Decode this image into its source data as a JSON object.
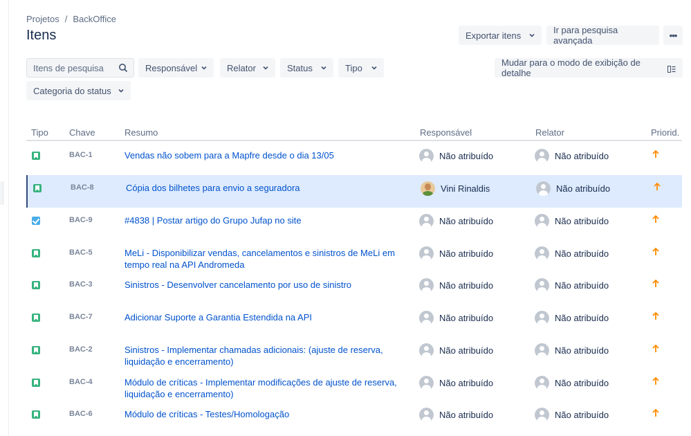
{
  "breadcrumb": {
    "project": "Projetos",
    "separator": "/",
    "current": "BackOffice"
  },
  "page": {
    "title": "Itens"
  },
  "toolbar": {
    "export_label": "Exportar itens",
    "advanced_search_label": "Ir para pesquisa avançada",
    "more_label": "•••",
    "detail_view_label": "Mudar para o modo de exibição de detalhe"
  },
  "filters": {
    "search_placeholder": "Itens de pesquisa",
    "assignee": "Responsável",
    "reporter": "Relator",
    "status": "Status",
    "type": "Tipo",
    "status_category": "Categoria do status"
  },
  "table": {
    "headers": {
      "type": "Tipo",
      "key": "Chave",
      "summary": "Resumo",
      "assignee": "Responsável",
      "reporter": "Relator",
      "priority": "Priorid."
    },
    "rows": [
      {
        "type": "story",
        "key": "BAC-1",
        "summary": "Vendas não sobem para a Mapfre desde o dia 13/05",
        "assignee": "Não atribuído",
        "reporter": "Não atribuído",
        "priority": "medium"
      },
      {
        "type": "story",
        "key": "BAC-8",
        "summary": "Cópia dos bilhetes para envio a seguradora",
        "assignee": "Vini Rinaldis",
        "reporter": "Não atribuído",
        "priority": "medium"
      },
      {
        "type": "task",
        "key": "BAC-9",
        "summary": "#4838 | Postar artigo do Grupo Jufap no site",
        "assignee": "Não atribuído",
        "reporter": "Não atribuído",
        "priority": "medium"
      },
      {
        "type": "story",
        "key": "BAC-5",
        "summary": "MeLi - Disponibilizar vendas, cancelamentos e sinistros de MeLi em tempo real na API Andromeda",
        "assignee": "Não atribuído",
        "reporter": "Não atribuído",
        "priority": "medium"
      },
      {
        "type": "story",
        "key": "BAC-3",
        "summary": "Sinistros - Desenvolver cancelamento por uso de sinistro",
        "assignee": "Não atribuído",
        "reporter": "Não atribuído",
        "priority": "medium"
      },
      {
        "type": "story",
        "key": "BAC-7",
        "summary": "Adicionar Suporte a Garantia Estendida na API",
        "assignee": "Não atribuído",
        "reporter": "Não atribuído",
        "priority": "medium"
      },
      {
        "type": "story",
        "key": "BAC-2",
        "summary": "Sinistros - Implementar chamadas adicionais: (ajuste de reserva, liquidação e encerramento)",
        "assignee": "Não atribuído",
        "reporter": "Não atribuído",
        "priority": "medium"
      },
      {
        "type": "story",
        "key": "BAC-4",
        "summary": "Módulo de críticas - Implementar modificações de ajuste de reserva, liquidação e encerramento)",
        "assignee": "Não atribuído",
        "reporter": "Não atribuído",
        "priority": "medium"
      },
      {
        "type": "story",
        "key": "BAC-6",
        "summary": "Módulo de críticas - Testes/Homologação",
        "assignee": "Não atribuído",
        "reporter": "Não atribuído",
        "priority": "medium"
      }
    ]
  },
  "colors": {
    "link": "#0052cc",
    "priority_medium": "#ff8b00",
    "story": "#36b37e",
    "task": "#4bade8",
    "selected_row": "#deebff"
  }
}
